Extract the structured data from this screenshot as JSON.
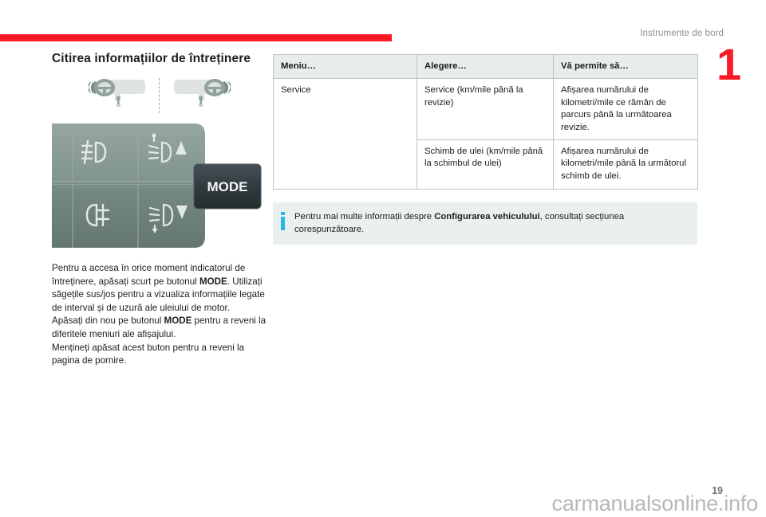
{
  "header": {
    "chapter_title": "Instrumente de bord",
    "chapter_number": "1",
    "rule_color": "#fc1926"
  },
  "left": {
    "page_title": "Citirea informațiilor de întreținere",
    "figure_dashboard": {
      "icon_left": "dashboard-left-hand-drive-icon",
      "icon_right": "dashboard-right-hand-drive-icon",
      "divider": "dashed-divider"
    },
    "figure_control_panel": {
      "mode_button_label": "MODE",
      "icons": [
        "front-fog-light-icon",
        "headlight-range-up-icon",
        "rear-fog-light-icon",
        "headlight-range-down-icon"
      ]
    },
    "body_paragraphs": [
      {
        "segments": [
          {
            "text": "Pentru a accesa în orice moment indicatorul de întreținere, apăsați scurt pe butonul ",
            "bold": false
          },
          {
            "text": "MODE",
            "bold": true
          },
          {
            "text": ". Utilizați săgețile sus/jos pentru a vizualiza informațiile legate de interval și de uzură ale uleiului de motor.",
            "bold": false
          }
        ]
      },
      {
        "segments": [
          {
            "text": "Apăsați din nou pe butonul ",
            "bold": false
          },
          {
            "text": "MODE",
            "bold": true
          },
          {
            "text": " pentru a reveni la diferitele meniuri ale afișajului.",
            "bold": false
          }
        ]
      },
      {
        "segments": [
          {
            "text": "Mențineți apăsat acest buton pentru a reveni la pagina de pornire.",
            "bold": false
          }
        ]
      }
    ]
  },
  "right": {
    "table": {
      "headers": [
        "Meniu…",
        "Alegere…",
        "Vă permite să…"
      ],
      "rows": [
        {
          "menu": "Service",
          "menu_rowspan": 2,
          "choice": "Service (km/mile până la revizie)",
          "allows": "Afișarea numărului de kilometri/mile ce rămân de parcurs până la următoarea revizie."
        },
        {
          "menu": null,
          "choice": "Schimb de ulei (km/mile până la schimbul de ulei)",
          "allows": "Afișarea numărului de kilometri/mile până la următorul schimb de ulei."
        }
      ]
    },
    "note": {
      "icon": "info-icon",
      "icon_color": "#29b6e8",
      "segments": [
        {
          "text": "Pentru mai multe informații despre ",
          "bold": false
        },
        {
          "text": "Configurarea vehiculului",
          "bold": true
        },
        {
          "text": ", consultați secțiunea corespunzătoare.",
          "bold": false
        }
      ]
    }
  },
  "footer": {
    "page_number": "19",
    "watermark": "carmanualsonline.info"
  }
}
